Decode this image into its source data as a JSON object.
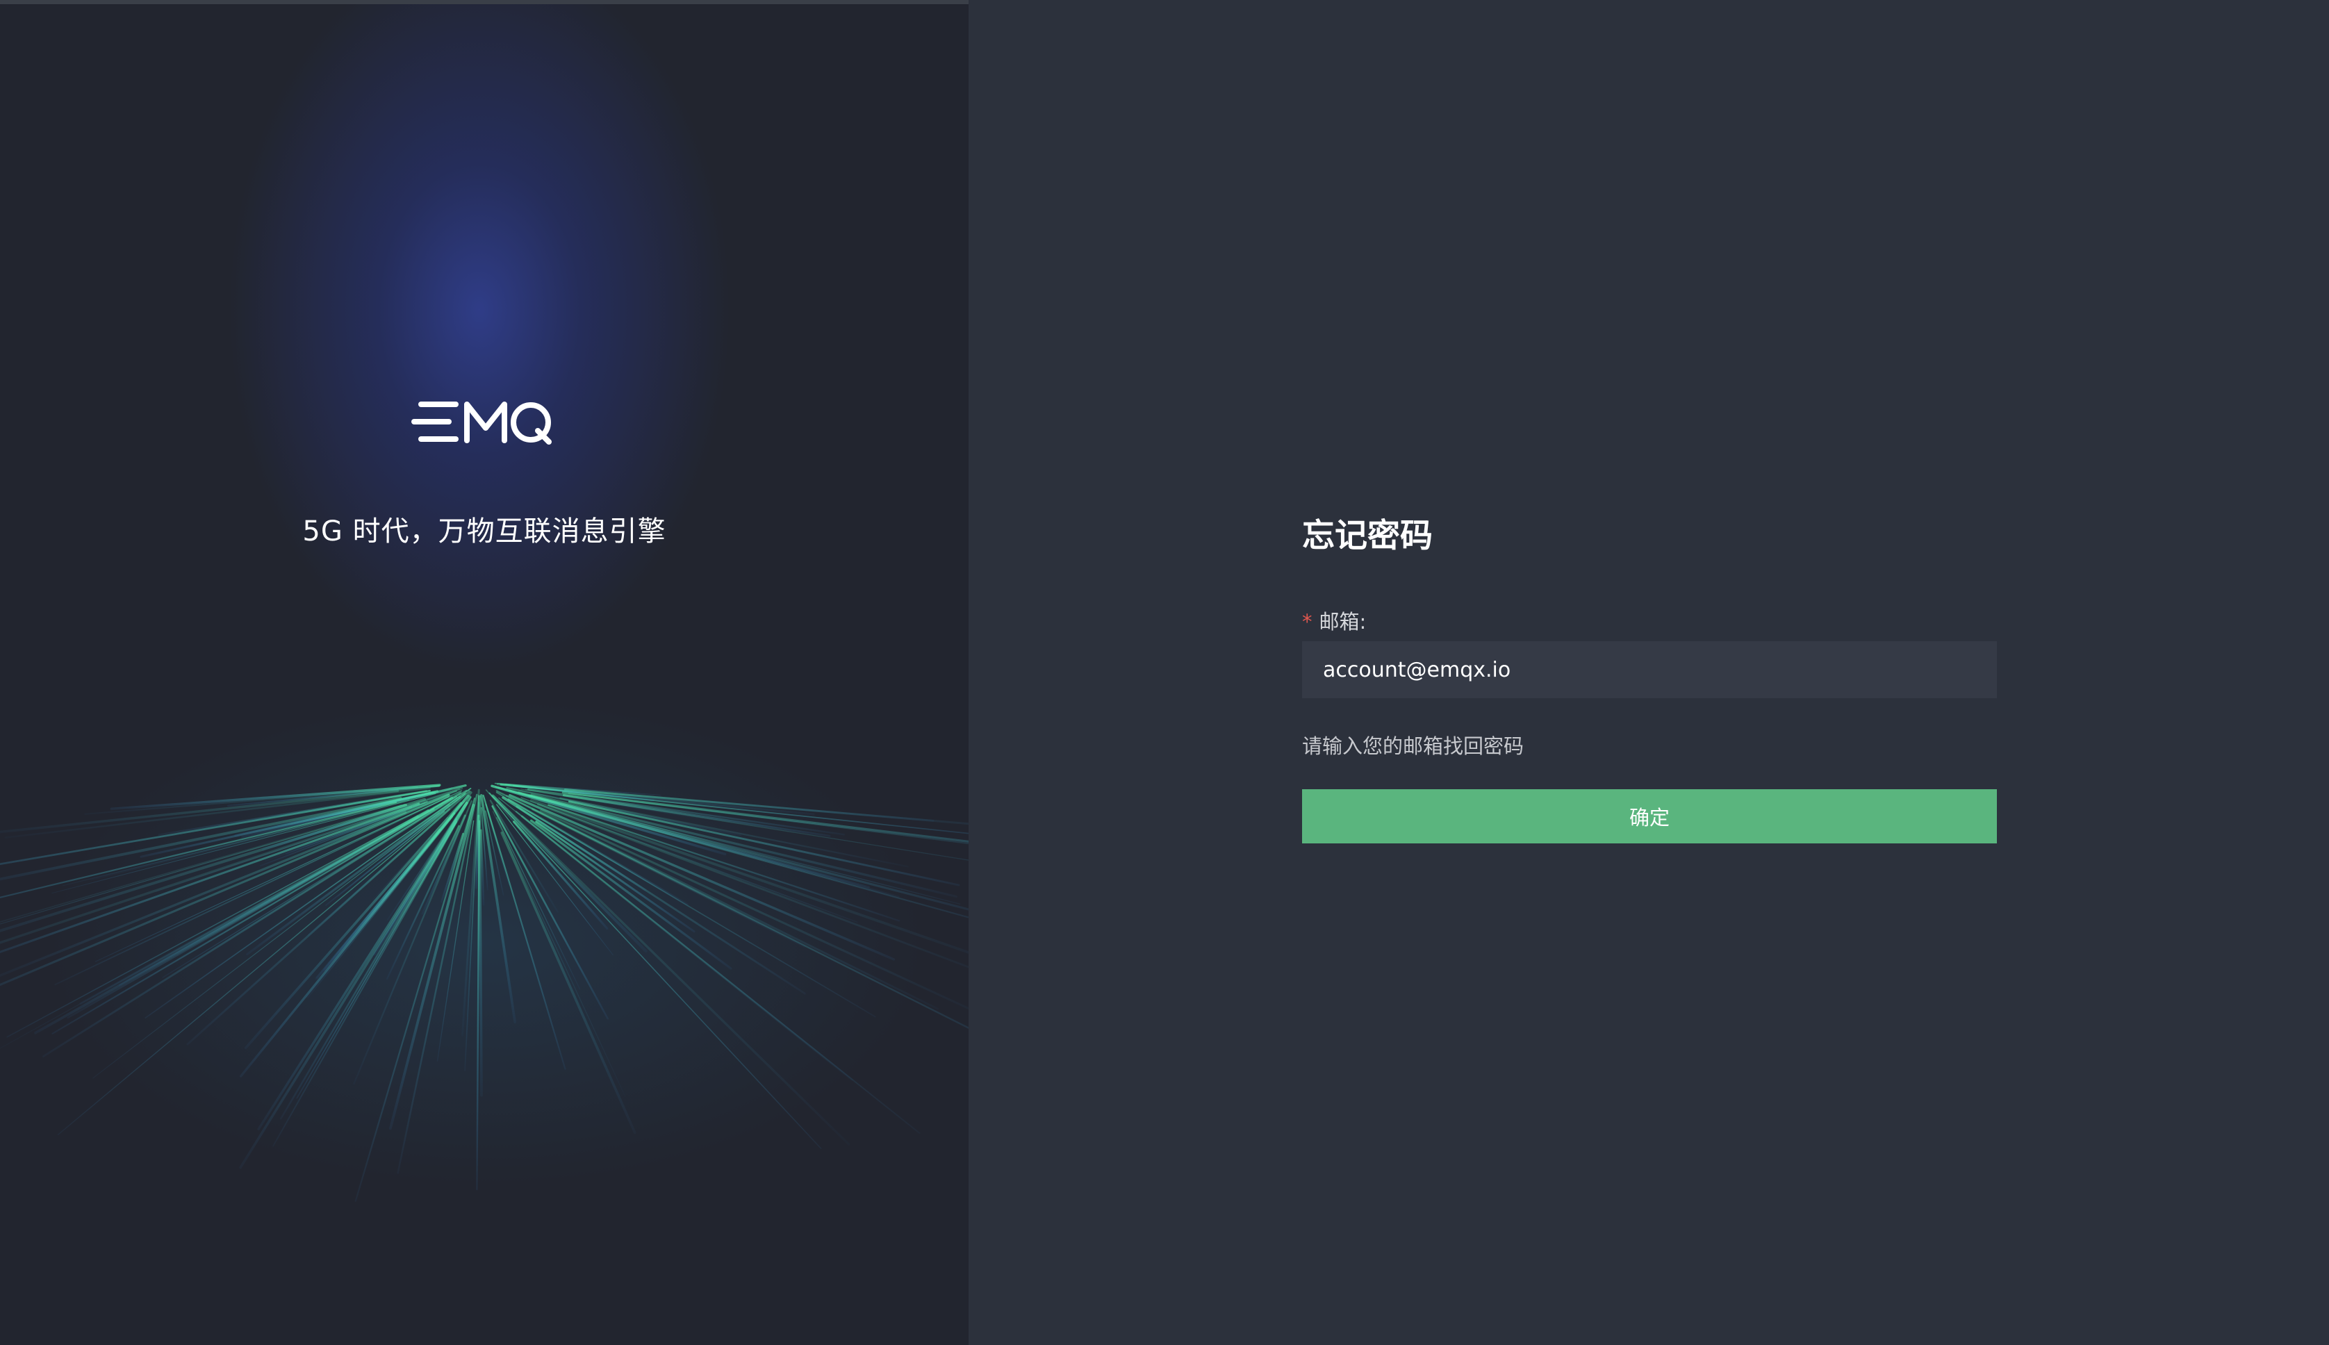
{
  "brand": {
    "logo_text": "EMQ",
    "tagline": "5G 时代，万物互联消息引擎"
  },
  "form": {
    "title": "忘记密码",
    "email_label": "邮箱:",
    "required_mark": "*",
    "email_value": "account@emqx.io",
    "hint": "请输入您的邮箱找回密码",
    "confirm_label": "确定"
  },
  "colors": {
    "accent": "#5ab57e",
    "background": "#2c313c",
    "left_panel": "#22252f",
    "required": "#e0574f"
  },
  "icons": [
    "emq-logo-icon",
    "light-rays-decoration"
  ]
}
